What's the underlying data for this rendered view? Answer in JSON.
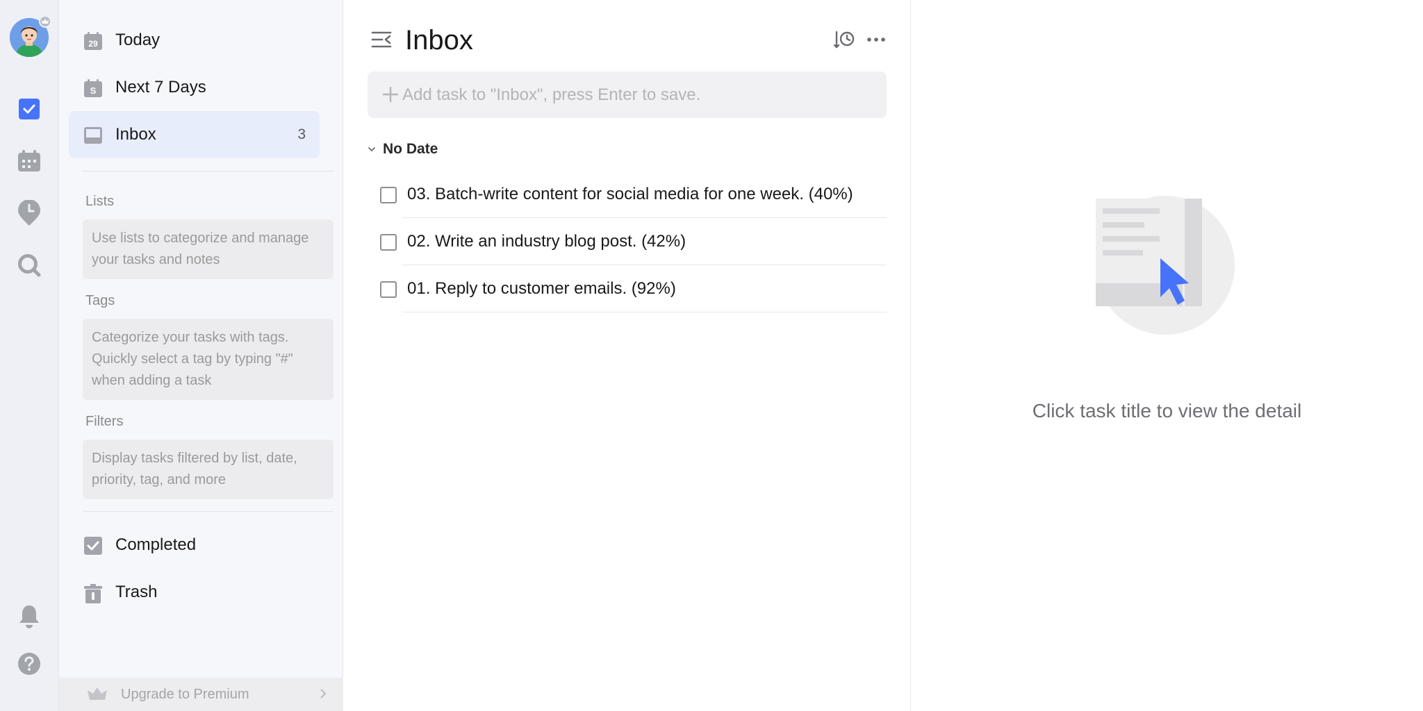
{
  "rail": {
    "avatar_icon": "user-avatar",
    "badge_icon": "crown-icon",
    "items": [
      {
        "icon": "checkbox-task-icon",
        "active": true
      },
      {
        "icon": "calendar-icon",
        "active": false
      },
      {
        "icon": "pomodoro-timer-icon",
        "active": false
      },
      {
        "icon": "search-icon",
        "active": false
      },
      {
        "icon": "bell-icon",
        "active": false
      },
      {
        "icon": "help-icon",
        "active": false
      }
    ]
  },
  "sidebar": {
    "smart_lists": [
      {
        "label": "Today",
        "icon": "calendar-date-icon",
        "icon_text": "29",
        "count": ""
      },
      {
        "label": "Next 7 Days",
        "icon": "calendar-week-icon",
        "icon_text": "S",
        "count": ""
      },
      {
        "label": "Inbox",
        "icon": "inbox-icon",
        "count": "3",
        "active": true
      }
    ],
    "lists": {
      "title": "Lists",
      "hint": "Use lists to categorize and manage your tasks and notes"
    },
    "tags": {
      "title": "Tags",
      "hint": "Categorize your tasks with tags. Quickly select a tag by typing \"#\" when adding a task"
    },
    "filters": {
      "title": "Filters",
      "hint": "Display tasks filtered by list, date, priority, tag, and more"
    },
    "bottom_lists": [
      {
        "label": "Completed",
        "icon": "completed-check-icon"
      },
      {
        "label": "Trash",
        "icon": "trash-icon"
      }
    ],
    "upgrade": {
      "label": "Upgrade to Premium",
      "icon": "crown-icon"
    }
  },
  "main": {
    "title": "Inbox",
    "add_task_placeholder": "Add task to \"Inbox\", press Enter to save.",
    "group": {
      "label": "No Date"
    },
    "tasks": [
      {
        "title": "03. Batch-write content for social media for one week. (40%)"
      },
      {
        "title": "02. Write an industry blog post. (42%)"
      },
      {
        "title": "01. Reply to customer emails. (92%)"
      }
    ]
  },
  "detail": {
    "empty_message": "Click task title to view the detail"
  },
  "colors": {
    "accent": "#4772fa",
    "rail_bg": "#eef0f6",
    "sidebar_bg": "#f6f7fa",
    "active_bg": "#e8edfc",
    "icon_gray": "#a2a4ac"
  }
}
